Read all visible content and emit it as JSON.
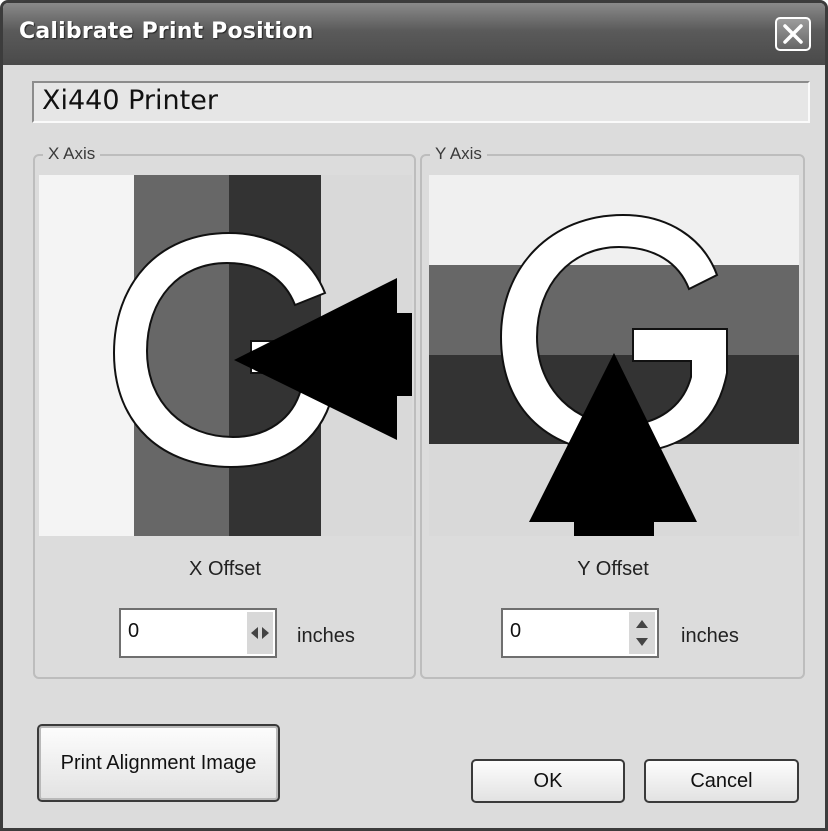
{
  "window": {
    "title": "Calibrate Print Position"
  },
  "printer": {
    "name": "Xi440 Printer"
  },
  "x_axis": {
    "group_label": "X Axis",
    "offset_label": "X Offset",
    "offset_value": "0",
    "units": "inches"
  },
  "y_axis": {
    "group_label": "Y Axis",
    "offset_label": "Y Offset",
    "offset_value": "0",
    "units": "inches"
  },
  "buttons": {
    "print_alignment": "Print Alignment Image",
    "ok": "OK",
    "cancel": "Cancel"
  },
  "icons": {
    "close": "close-icon",
    "x_spinner": "left-right-arrows-icon",
    "y_spinner": "up-down-arrows-icon",
    "x_pointer": "arrow-left-icon",
    "y_pointer": "arrow-up-icon"
  },
  "colors": {
    "titlebar": "#5a5a5a",
    "dialog_bg": "#dcdcdc",
    "band_dark": "#333333",
    "band_mid": "#666666",
    "band_light": "#f0f0f0",
    "band_lightgray": "#d8d8d8"
  }
}
